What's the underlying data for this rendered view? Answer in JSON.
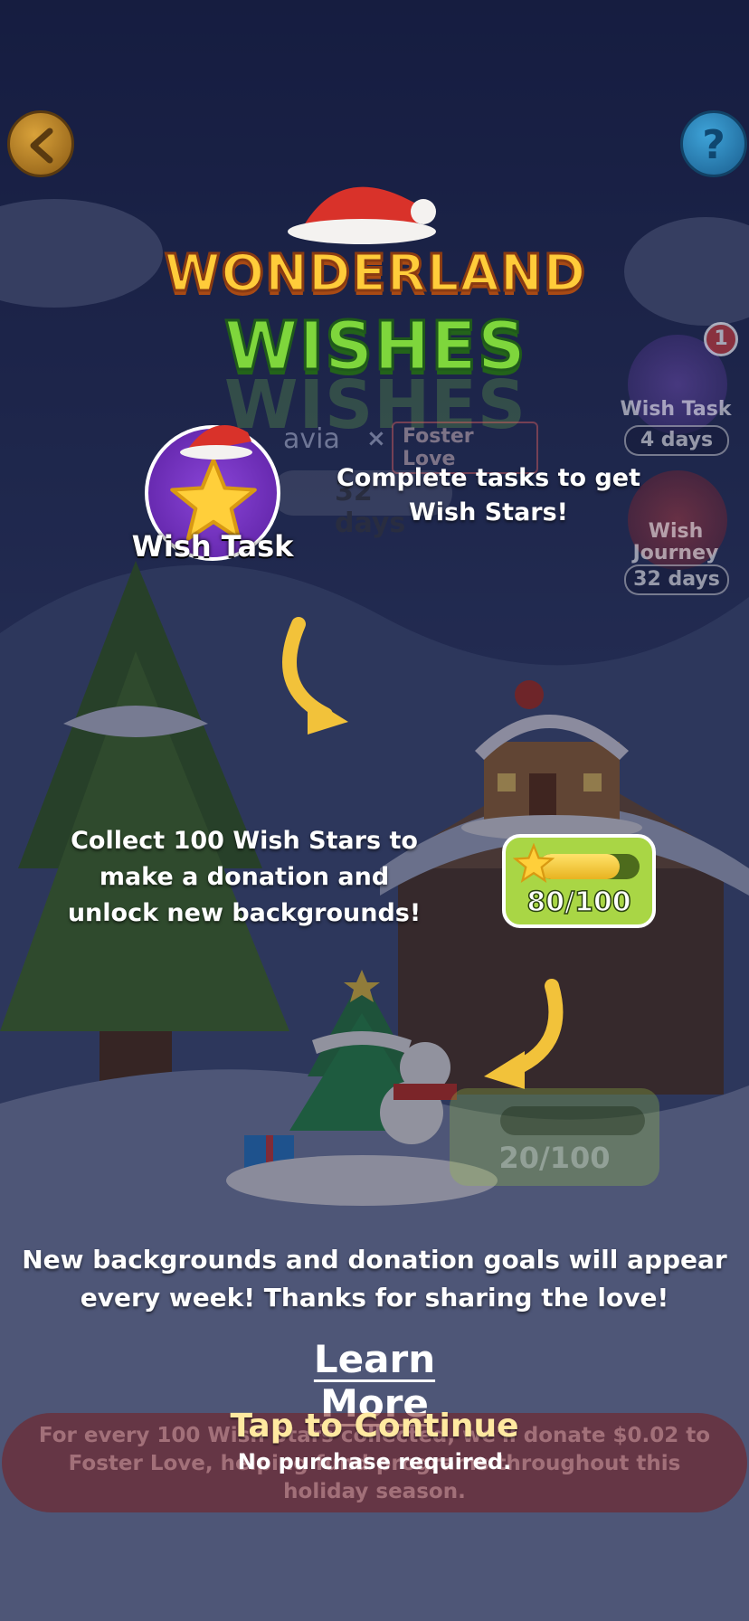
{
  "nav": {
    "back_icon": "chevron-left-icon",
    "help_label": "?"
  },
  "logo": {
    "line1": "WONDERLAND",
    "line2": "WISHES"
  },
  "partners": {
    "left": "avia",
    "separator": "×",
    "right": "Foster Love"
  },
  "countdown": {
    "value": "32 days"
  },
  "side_panel": {
    "wish_task_label": "Wish Task",
    "wish_task_days": "4 days",
    "wish_task_badge": "1",
    "wish_journey_label": "Wish Journey",
    "wish_journey_days": "32 days"
  },
  "tutorial": {
    "wish_task_label": "Wish Task",
    "tip1": "Complete tasks to get Wish Stars!",
    "tip2": "Collect 100 Wish Stars to make a donation and unlock new backgrounds!",
    "tip3": "New backgrounds and donation goals will appear every week! Thanks for sharing the love!",
    "progress_text": "80/100",
    "progress_fraction": 0.8,
    "progress2_text": "20/100",
    "learn_more": "Learn More",
    "tap_continue": "Tap to Continue",
    "no_purchase": "No purchase required."
  },
  "footer": {
    "text": "For every 100 Wish Stars collected, we'll donate $0.02 to Foster Love, helping fund programs throughout this holiday season."
  },
  "colors": {
    "accent_green": "#a9d645",
    "accent_gold": "#ffcc3a",
    "wish_task_purple": "#8a45d8",
    "tap_color": "#ffe9a0"
  }
}
